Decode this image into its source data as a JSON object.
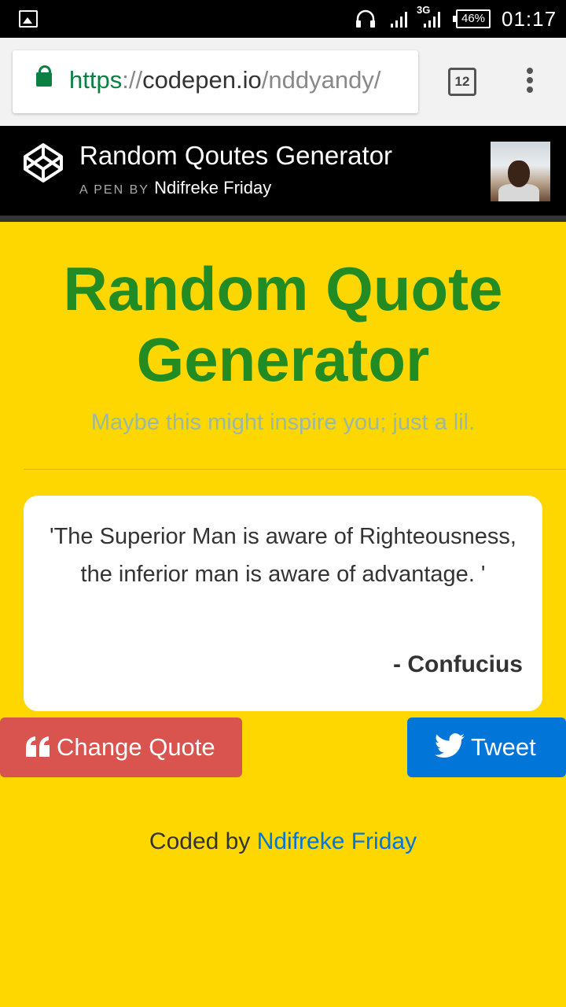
{
  "status_bar": {
    "network_type": "3G",
    "battery": "46%",
    "time": "01:17",
    "icons": [
      "image-notification-icon",
      "headset-icon",
      "signal-icon",
      "battery-icon"
    ]
  },
  "browser": {
    "url_scheme": "https",
    "url_separator": "://",
    "url_host": "codepen.io",
    "url_path": "/nddyandy/",
    "tab_count": "12"
  },
  "codepen_header": {
    "title": "Random Qoutes Generator",
    "byline": "A PEN BY",
    "author": "Ndifreke Friday"
  },
  "page": {
    "title": "Random Quote Generator",
    "subtitle": "Maybe this might inspire you; just a lil."
  },
  "quote": {
    "text": "'The Superior Man is aware of Righteousness, the inferior man is aware of advantage. '",
    "author": "- Confucius"
  },
  "buttons": {
    "change_quote": "Change Quote",
    "tweet": "Tweet"
  },
  "footer": {
    "prefix": "Coded by",
    "author_link": "Ndifreke Friday"
  },
  "colors": {
    "background": "#ffd700",
    "title": "#228b22",
    "change_button": "#d9534f",
    "tweet_button": "#0275d8"
  }
}
